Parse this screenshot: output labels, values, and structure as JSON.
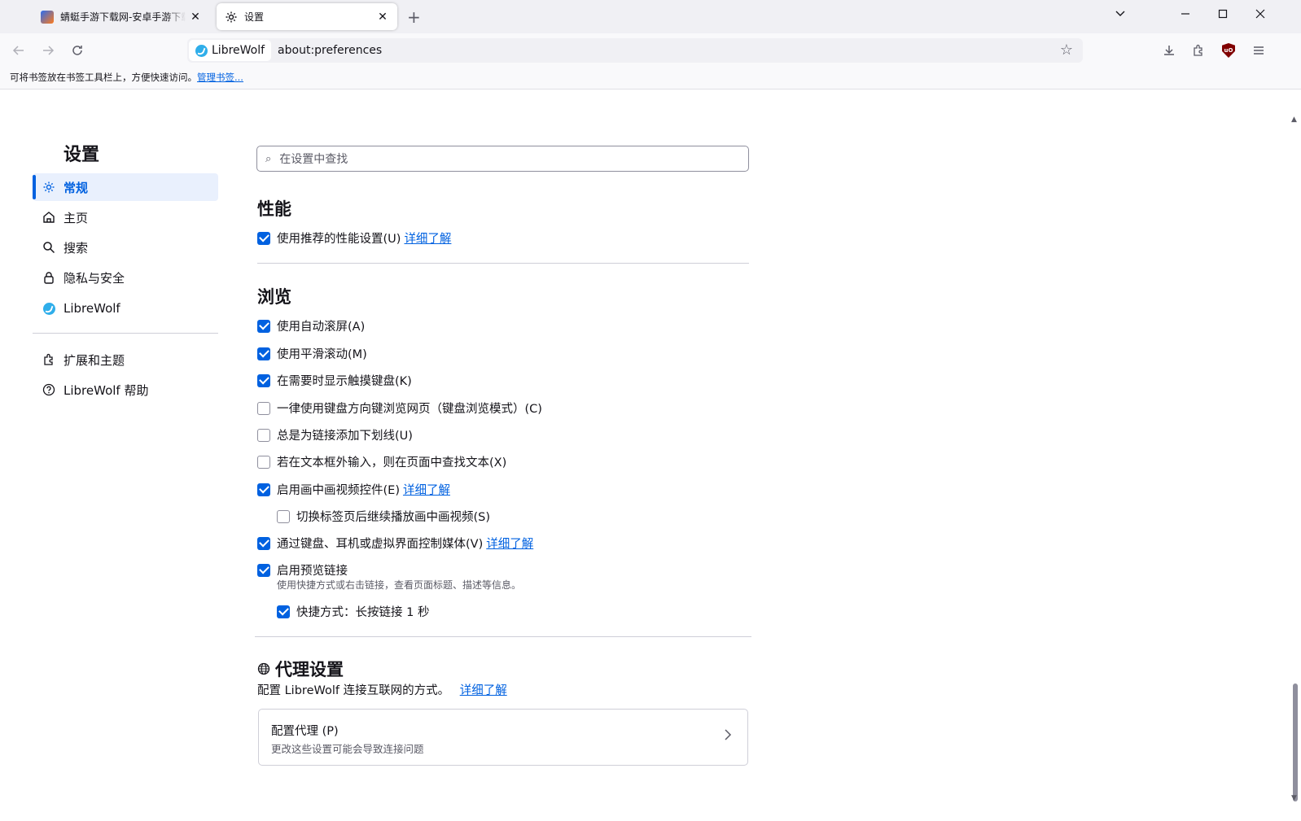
{
  "tabs": [
    {
      "title": "蜻蜓手游下载网-安卓手游下载站",
      "active": false,
      "icon": "game-favicon"
    },
    {
      "title": "设置",
      "active": true,
      "icon": "gear-icon"
    }
  ],
  "window_controls": {
    "list_all_tabs": "⌄",
    "minimize": "—",
    "maximize": "☐",
    "close": "✕"
  },
  "urlbar": {
    "identity_label": "LibreWolf",
    "url": "about:preferences"
  },
  "bookmarks_bar": {
    "message": "可将书签放在书签工具栏上，方便快速访问。",
    "manage_link": "管理书签..."
  },
  "sidebar": {
    "title": "设置",
    "categories": [
      {
        "label": "常规",
        "icon": "gear-icon",
        "selected": true
      },
      {
        "label": "主页",
        "icon": "home-icon",
        "selected": false
      },
      {
        "label": "搜索",
        "icon": "search-icon",
        "selected": false
      },
      {
        "label": "隐私与安全",
        "icon": "lock-icon",
        "selected": false
      },
      {
        "label": "LibreWolf",
        "icon": "librewolf-icon",
        "selected": false
      }
    ],
    "footer": [
      {
        "label": "扩展和主题",
        "icon": "puzzle-icon"
      },
      {
        "label": "LibreWolf 帮助",
        "icon": "help-icon"
      }
    ]
  },
  "search": {
    "placeholder": "在设置中查找"
  },
  "performance": {
    "heading": "性能",
    "recommended": {
      "label": "使用推荐的性能设置(U)",
      "checked": true,
      "link": "详细了解"
    }
  },
  "browsing": {
    "heading": "浏览",
    "options": [
      {
        "label": "使用自动滚屏(A)",
        "checked": true
      },
      {
        "label": "使用平滑滚动(M)",
        "checked": true
      },
      {
        "label": "在需要时显示触摸键盘(K)",
        "checked": true
      },
      {
        "label": "一律使用键盘方向键浏览网页（键盘浏览模式）(C)",
        "checked": false
      },
      {
        "label": "总是为链接添加下划线(U)",
        "checked": false
      },
      {
        "label": "若在文本框外输入，则在页面中查找文本(X)",
        "checked": false
      },
      {
        "label": "启用画中画视频控件(E)",
        "checked": true,
        "link": "详细了解"
      },
      {
        "label": "切换标签页后继续播放画中画视频(S)",
        "checked": false
      },
      {
        "label": "通过键盘、耳机或虚拟界面控制媒体(V)",
        "checked": true,
        "link": "详细了解"
      },
      {
        "label": "启用预览链接",
        "checked": true,
        "description": "使用快捷方式或右击链接，查看页面标题、描述等信息。"
      },
      {
        "label": "快捷方式：长按链接 1 秒",
        "checked": true
      }
    ]
  },
  "proxy": {
    "heading": "代理设置",
    "description": "配置 LibreWolf 连接互联网的方式。",
    "link": "详细了解",
    "button_title": "配置代理 (P)",
    "button_subtitle": "更改这些设置可能会导致连接问题"
  },
  "colors": {
    "accent": "#0061e0",
    "selected_bg": "#e9f0fd"
  }
}
